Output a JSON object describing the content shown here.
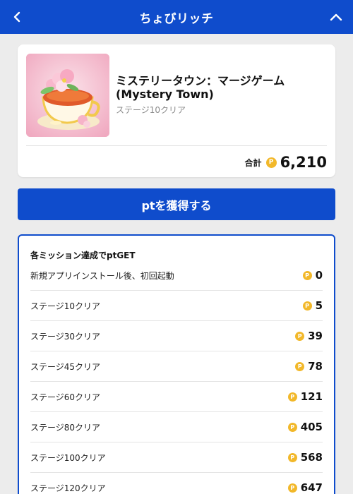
{
  "header": {
    "title": "ちょびリッチ",
    "back_icon": "chevron-left-icon",
    "collapse_icon": "chevron-up-icon",
    "bg_color": "#0f4ccc"
  },
  "app": {
    "title": "ミステリータウン：マージゲーム\n(Mystery Town)",
    "subtitle": "ステージ10クリア",
    "total_label": "合計",
    "total_value": "6,210",
    "icon": "teacup-flower-app-icon"
  },
  "coin_glyph": "P",
  "get_button_label": "ptを獲得する",
  "missions": {
    "heading": "各ミッション達成でptGET",
    "items": [
      {
        "label": "新規アプリインストール後、初回起動",
        "points": "0"
      },
      {
        "label": "ステージ10クリア",
        "points": "5"
      },
      {
        "label": "ステージ30クリア",
        "points": "39"
      },
      {
        "label": "ステージ45クリア",
        "points": "78"
      },
      {
        "label": "ステージ60クリア",
        "points": "121"
      },
      {
        "label": "ステージ80クリア",
        "points": "405"
      },
      {
        "label": "ステージ100クリア",
        "points": "568"
      },
      {
        "label": "ステージ120クリア",
        "points": "647"
      }
    ]
  }
}
